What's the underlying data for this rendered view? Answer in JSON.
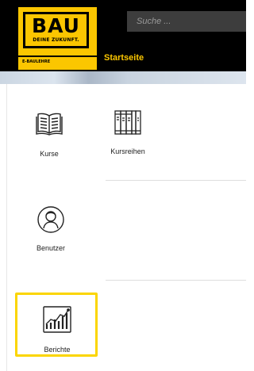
{
  "logo": {
    "brand": "BAU",
    "slogan": "DEINE ZUKUNFT.",
    "tagline": "E-BAULEHRE"
  },
  "search": {
    "placeholder": "Suche ..."
  },
  "nav": {
    "home_label": "Startseite"
  },
  "tiles": [
    {
      "label": "Kurse",
      "icon": "book-icon"
    },
    {
      "label": "Kursreihen",
      "icon": "books-row-icon"
    },
    {
      "label": "Benutzer",
      "icon": "user-icon"
    },
    {
      "label": "Berichte",
      "icon": "chart-icon",
      "highlighted": true
    }
  ],
  "colors": {
    "brand_yellow": "#fbc600",
    "topbar": "#000000",
    "search_bg": "#3d3d3d",
    "highlight_border": "#fbd500"
  }
}
